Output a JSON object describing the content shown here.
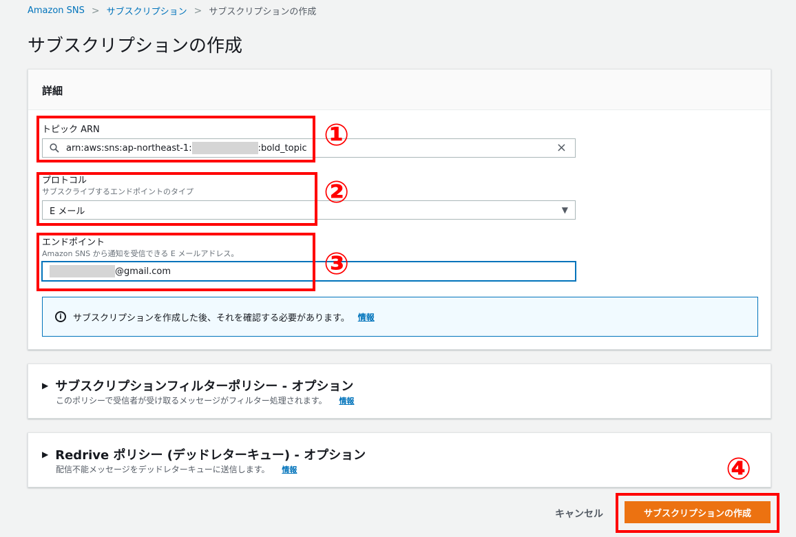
{
  "breadcrumb": {
    "items": [
      "Amazon SNS",
      "サブスクリプション"
    ],
    "current": "サブスクリプションの作成",
    "separator": ">"
  },
  "page": {
    "title": "サブスクリプションの作成"
  },
  "details": {
    "header": "詳細",
    "topic": {
      "label": "トピック ARN",
      "value_prefix": "arn:aws:sns:ap-northeast-1:",
      "value_suffix": ":bold_topic",
      "icon": "search-icon",
      "clear_icon": "×"
    },
    "protocol": {
      "label": "プロトコル",
      "description": "サブスクライブするエンドポイントのタイプ",
      "selected": "E メール"
    },
    "endpoint": {
      "label": "エンドポイント",
      "description": "Amazon SNS から通知を受信できる E メールアドレス。",
      "value_suffix": "@gmail.com"
    },
    "alert": {
      "text": "サブスクリプションを作成した後、それを確認する必要があります。",
      "link": "情報"
    }
  },
  "filter_policy": {
    "title": "サブスクリプションフィルターポリシー - オプション",
    "description": "このポリシーで受信者が受け取るメッセージがフィルター処理されます。",
    "link": "情報"
  },
  "redrive_policy": {
    "title": "Redrive ポリシー (デッドレターキュー) - オプション",
    "description": "配信不能メッセージをデッドレターキューに送信します。",
    "link": "情報"
  },
  "actions": {
    "cancel": "キャンセル",
    "create": "サブスクリプションの作成"
  },
  "annotations": [
    "①",
    "②",
    "③",
    "④"
  ],
  "colors": {
    "accent_orange": "#ec7211",
    "link_blue": "#0073bb",
    "annotation_red": "#ff0000"
  }
}
